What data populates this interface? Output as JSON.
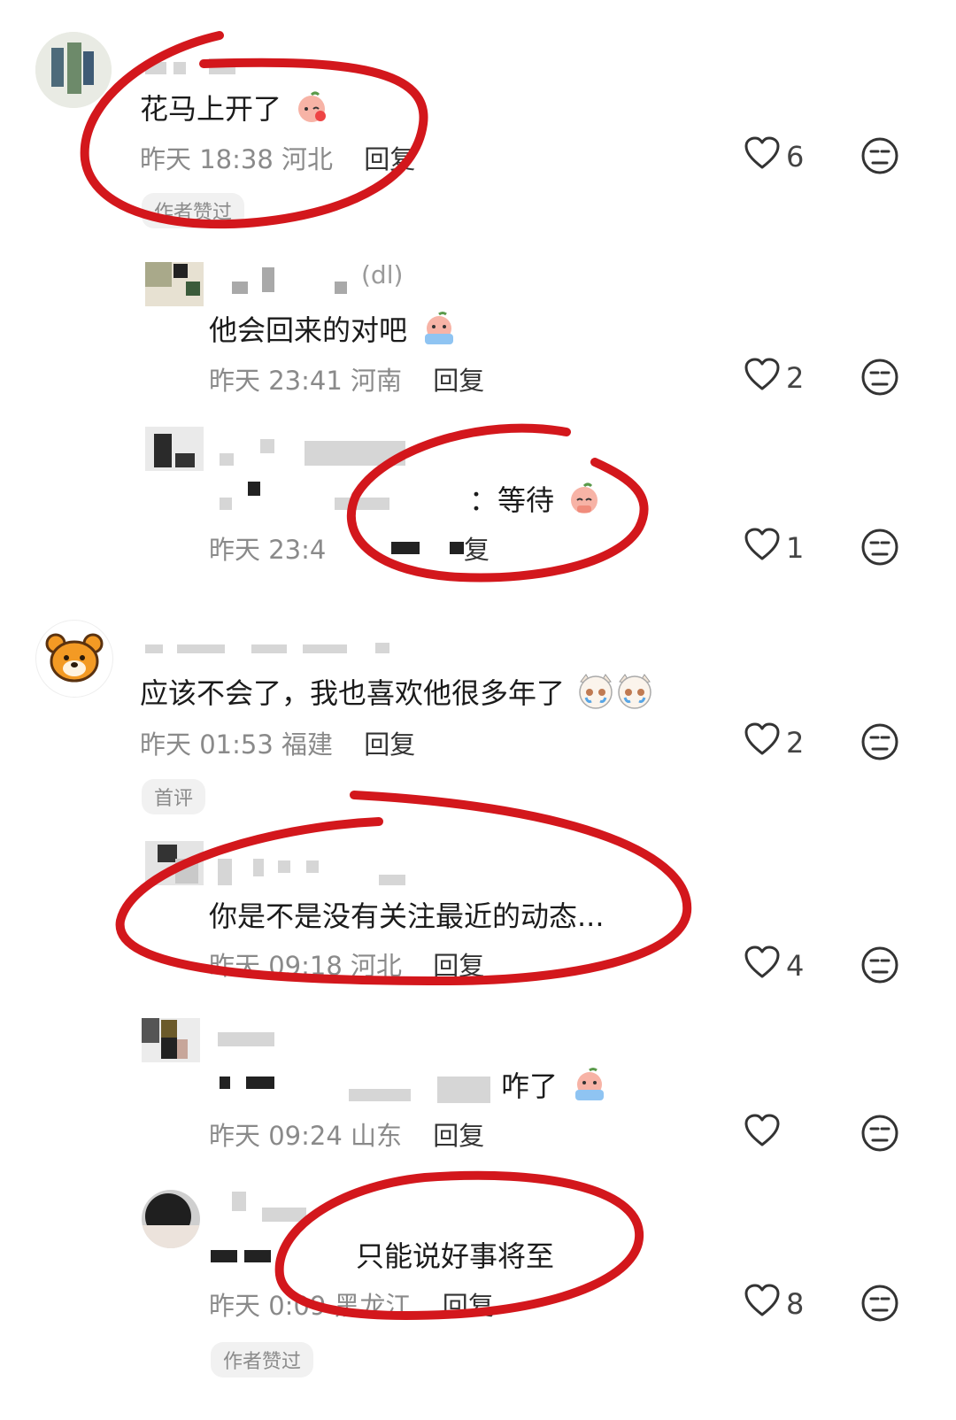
{
  "comments": [
    {
      "name_suffix": "",
      "text": "花马上开了",
      "time": "昨天 18:38",
      "location": "河北",
      "reply_label": "回复",
      "likes": "6",
      "tag": "作者赞过"
    },
    {
      "name_suffix": "(dl)",
      "text": "他会回来的对吧",
      "time": "昨天 23:41",
      "location": "河南",
      "reply_label": "回复",
      "likes": "2"
    },
    {
      "text": "：等待",
      "time": "昨天 23:4",
      "reply_label": "复",
      "likes": "1"
    },
    {
      "text": "应该不会了，我也喜欢他很多年了",
      "time": "昨天 01:53",
      "location": "福建",
      "reply_label": "回复",
      "likes": "2",
      "tag": "首评"
    },
    {
      "text": "你是不是没有关注最近的动态...",
      "time": "昨天 09:18",
      "location": "河北",
      "reply_label": "回复",
      "likes": "4"
    },
    {
      "text": "咋了",
      "time": "昨天 09:24",
      "location": "山东",
      "reply_label": "回复",
      "likes": ""
    },
    {
      "text": "只能说好事将至",
      "time": "昨天 ",
      "location": "0:09 黑龙江",
      "reply_label": "回复",
      "likes": "8",
      "tag": "作者赞过"
    }
  ],
  "colors": {
    "annotation": "#d3171c",
    "meta": "#8a8a8a",
    "text": "#1b1b1b"
  },
  "icons": [
    "heart-icon",
    "dislike-face-icon",
    "emoji-peach-icon",
    "emoji-cat-icon",
    "bear-avatar-icon"
  ]
}
